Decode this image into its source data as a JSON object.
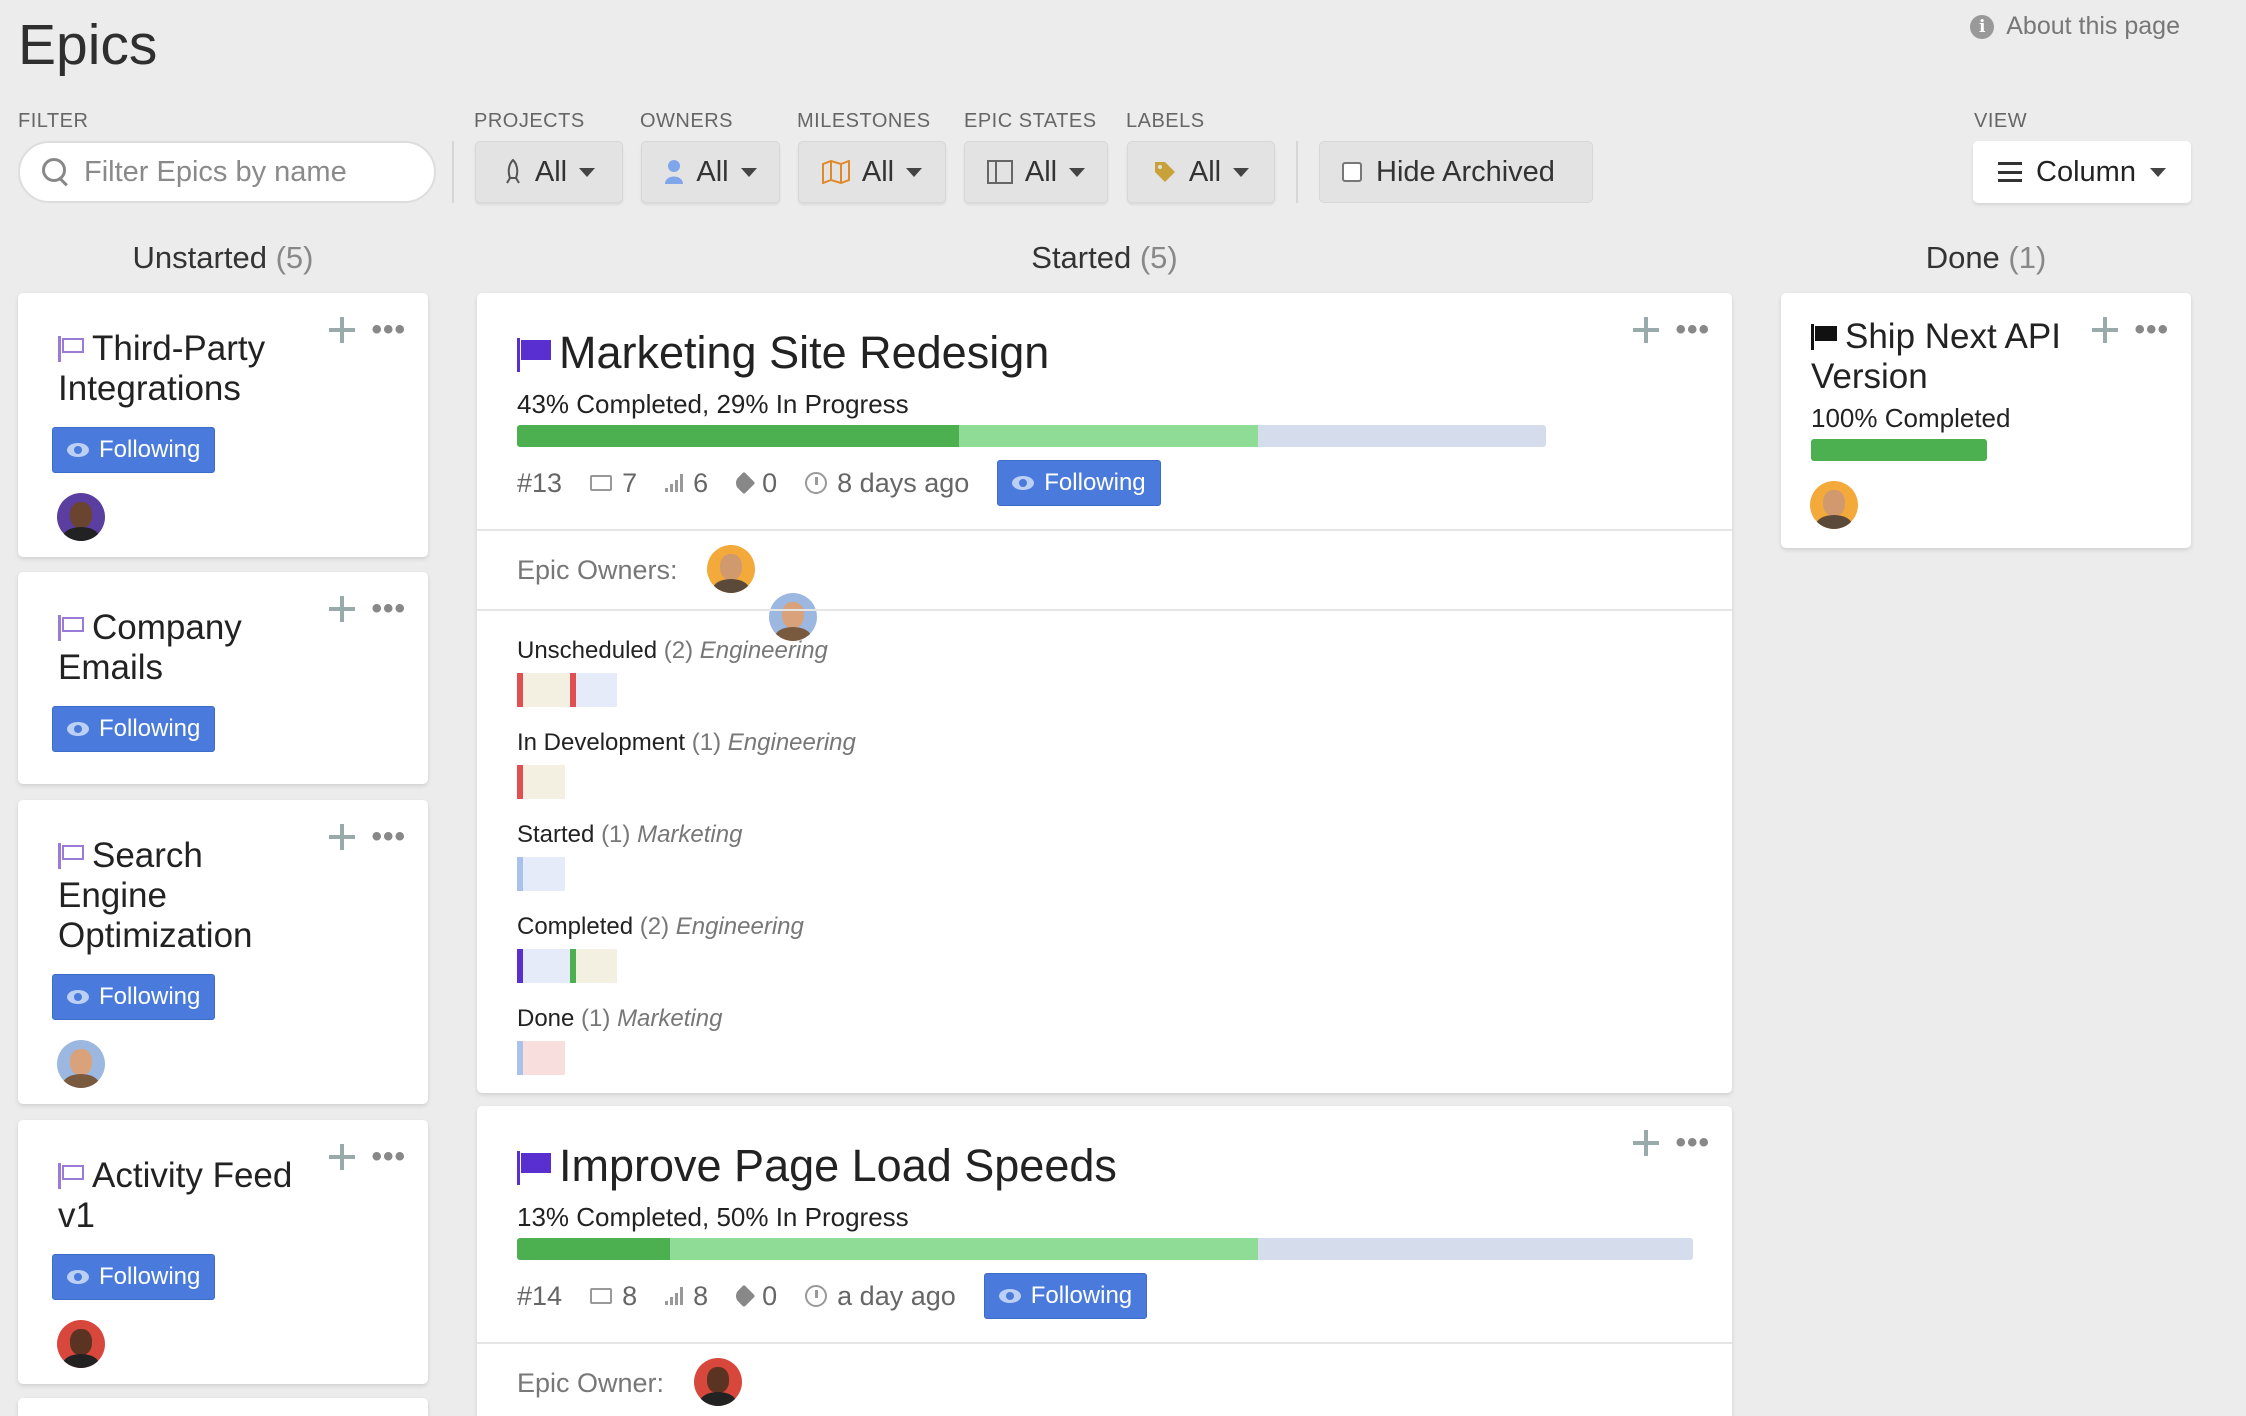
{
  "page": {
    "title": "Epics",
    "about": "About this page"
  },
  "filters": {
    "filter_label": "FILTER",
    "search_placeholder": "Filter Epics by name",
    "projects": {
      "label": "PROJECTS",
      "value": "All"
    },
    "owners": {
      "label": "OWNERS",
      "value": "All"
    },
    "milestones": {
      "label": "MILESTONES",
      "value": "All"
    },
    "epic_states": {
      "label": "EPIC STATES",
      "value": "All"
    },
    "labels": {
      "label": "LABELS",
      "value": "All"
    },
    "hide_archived": "Hide Archived",
    "view": {
      "label": "VIEW",
      "value": "Column"
    }
  },
  "columns": {
    "unstarted": {
      "name": "Unstarted",
      "count": "(5)"
    },
    "started": {
      "name": "Started",
      "count": "(5)"
    },
    "done": {
      "name": "Done",
      "count": "(1)"
    }
  },
  "unstarted_cards": [
    {
      "title_line1": "Third-Party",
      "title_line2": "Integrations",
      "follow": "Following"
    },
    {
      "title_line1": "Company",
      "title_line2": "Emails",
      "follow": "Following"
    },
    {
      "title_line1": "Search",
      "title_line2": "Engine",
      "title_line3": "Optimization",
      "follow": "Following"
    },
    {
      "title_line1": "Activity Feed",
      "title_line2": "v1",
      "follow": "Following"
    }
  ],
  "started_cards": [
    {
      "title": "Marketing Site Redesign",
      "progress_text": "43% Completed, 29% In Progress",
      "progress": {
        "completed": 43,
        "in_progress": 29
      },
      "id": "#13",
      "comments": "7",
      "points": "6",
      "labels": "0",
      "updated": "8 days ago",
      "follow": "Following",
      "owners_label": "Epic Owners:",
      "workflows": [
        {
          "state": "Unscheduled",
          "count": "(2)",
          "team": "Engineering"
        },
        {
          "state": "In Development",
          "count": "(1)",
          "team": "Engineering"
        },
        {
          "state": "Started",
          "count": "(1)",
          "team": "Marketing"
        },
        {
          "state": "Completed",
          "count": "(2)",
          "team": "Engineering"
        },
        {
          "state": "Done",
          "count": "(1)",
          "team": "Marketing"
        }
      ]
    },
    {
      "title": "Improve Page Load Speeds",
      "progress_text": "13% Completed, 50% In Progress",
      "progress": {
        "completed": 13,
        "in_progress": 50
      },
      "id": "#14",
      "comments": "8",
      "points": "8",
      "labels": "0",
      "updated": "a day ago",
      "follow": "Following",
      "owners_label": "Epic Owner:"
    }
  ],
  "done_cards": [
    {
      "title_line1": "Ship Next API",
      "title_line2": "Version",
      "progress_text": "100% Completed",
      "progress": {
        "completed": 100,
        "in_progress": 0
      }
    }
  ],
  "colors": {
    "accent": "#4a7bdc",
    "completed": "#4caf50",
    "in_progress": "#8fdc96",
    "remaining": "#d5dcec",
    "epic_flag": "#5a2fd0"
  }
}
